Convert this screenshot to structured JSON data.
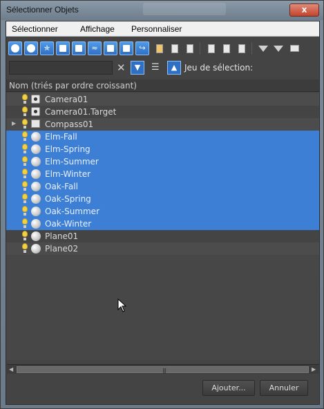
{
  "window": {
    "title": "Sélectionner Objets",
    "close_label": "x"
  },
  "menu": {
    "items": [
      "Sélectionner",
      "Affichage",
      "Personnaliser"
    ]
  },
  "toolbar": {
    "filter_icons": [
      "geometry-icon",
      "shape-icon",
      "light-icon",
      "camera-icon",
      "helper-icon",
      "spacewarp-icon",
      "group-icon",
      "xref-icon",
      "bone-icon",
      "container-icon",
      "frozen-icon",
      "hidden-icon"
    ],
    "list_icons": [
      "select-all-icon",
      "select-none-icon",
      "invert-icon"
    ],
    "filter_icons2": [
      "filter-icon",
      "filter-clear-icon",
      "collapse-icon"
    ]
  },
  "search": {
    "value": "",
    "placeholder": ""
  },
  "selection_set": {
    "label": "Jeu de sélection:"
  },
  "list": {
    "header": "Nom (triés par ordre croissant)",
    "rows": [
      {
        "name": "Camera01",
        "type": "camera",
        "selected": false,
        "expandable": false
      },
      {
        "name": "Camera01.Target",
        "type": "camera",
        "selected": false,
        "expandable": false
      },
      {
        "name": "Compass01",
        "type": "compass",
        "selected": false,
        "expandable": true
      },
      {
        "name": "Elm-Fall",
        "type": "sphere",
        "selected": true,
        "expandable": false
      },
      {
        "name": "Elm-Spring",
        "type": "sphere",
        "selected": true,
        "expandable": false
      },
      {
        "name": "Elm-Summer",
        "type": "sphere",
        "selected": true,
        "expandable": false
      },
      {
        "name": "Elm-Winter",
        "type": "sphere",
        "selected": true,
        "expandable": false
      },
      {
        "name": "Oak-Fall",
        "type": "sphere",
        "selected": true,
        "expandable": false
      },
      {
        "name": "Oak-Spring",
        "type": "sphere",
        "selected": true,
        "expandable": false
      },
      {
        "name": "Oak-Summer",
        "type": "sphere",
        "selected": true,
        "expandable": false
      },
      {
        "name": "Oak-Winter",
        "type": "sphere",
        "selected": true,
        "expandable": false
      },
      {
        "name": "Plane01",
        "type": "sphere",
        "selected": false,
        "expandable": false
      },
      {
        "name": "Plane02",
        "type": "sphere",
        "selected": false,
        "expandable": false
      }
    ]
  },
  "buttons": {
    "add": "Ajouter...",
    "cancel": "Annuler"
  },
  "colors": {
    "selection": "#3e7fd6",
    "background": "#444444"
  }
}
